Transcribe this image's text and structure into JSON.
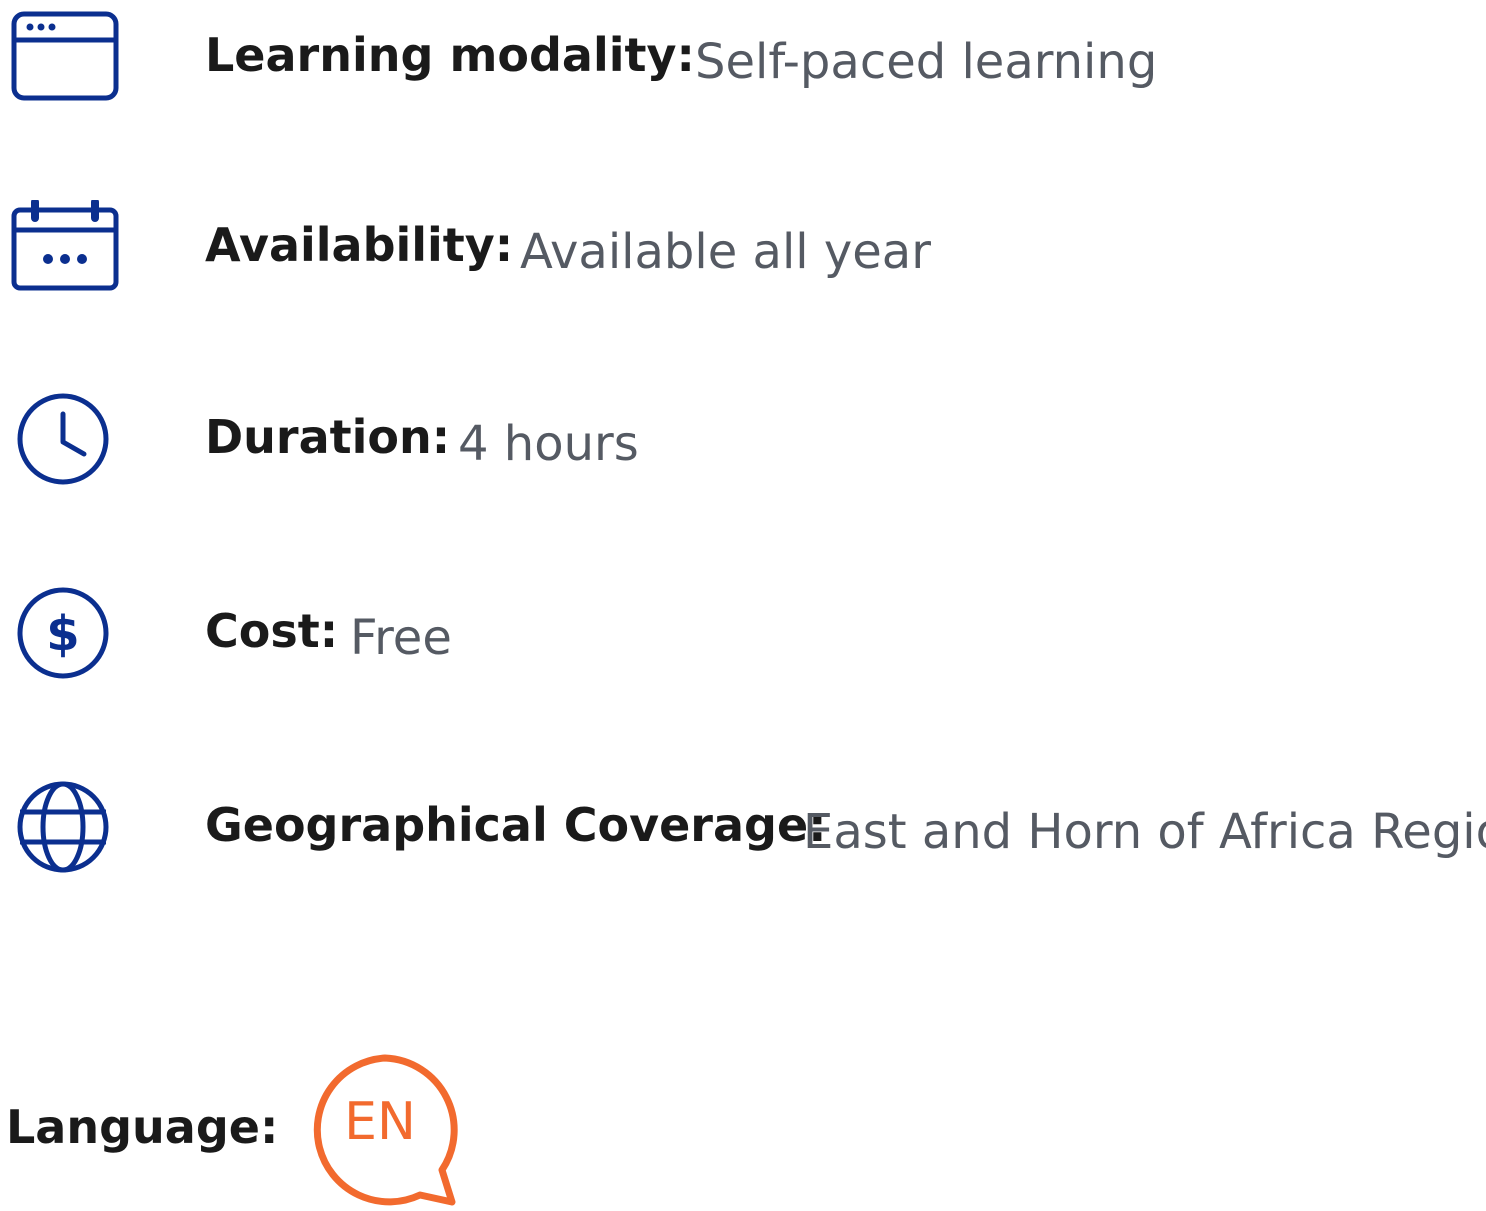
{
  "colors": {
    "icon_blue": "#0b2f8f",
    "language_orange": "#f26a2e",
    "value_gray": "#555a63"
  },
  "details": [
    {
      "icon": "browser-window-icon",
      "label": "Learning modality:",
      "value": "Self-paced learning"
    },
    {
      "icon": "calendar-icon",
      "label": "Availability:",
      "value": "Available all year"
    },
    {
      "icon": "clock-icon",
      "label": "Duration:",
      "value": "4 hours"
    },
    {
      "icon": "dollar-icon",
      "label": "Cost:",
      "value": "Free"
    },
    {
      "icon": "globe-icon",
      "label": "Geographical Coverage:",
      "value": "East and Horn of Africa Region"
    }
  ],
  "language": {
    "label": "Language:",
    "badge": "EN",
    "icon": "speech-bubble-icon"
  }
}
